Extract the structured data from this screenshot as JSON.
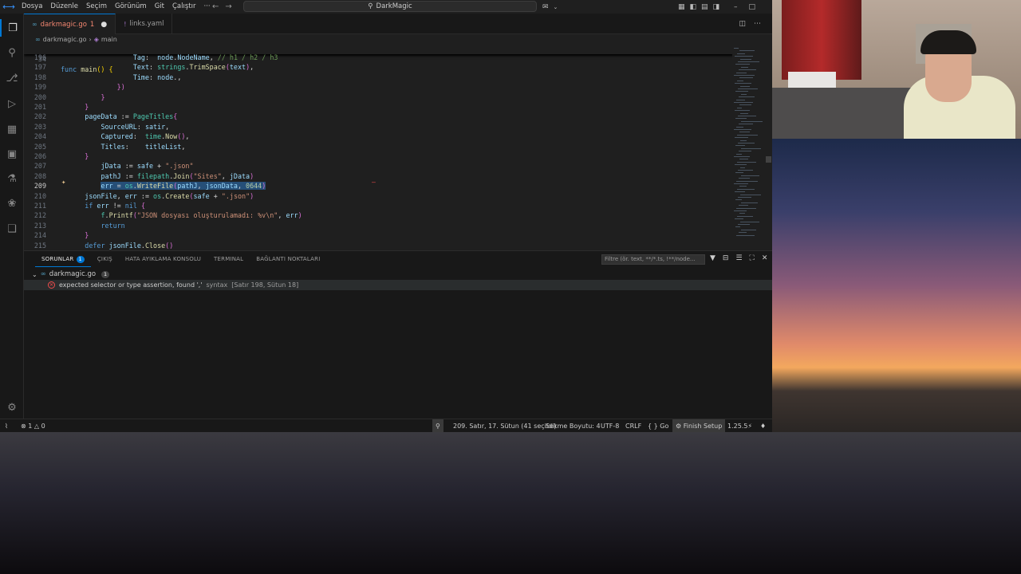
{
  "titlebar": {
    "menus": [
      "Dosya",
      "Düzenle",
      "Seçim",
      "Görünüm",
      "Git",
      "Çalıştır",
      "···"
    ],
    "search_text": "DarkMagic",
    "back_icon": "arrow-left-icon",
    "forward_icon": "arrow-right-icon"
  },
  "tabs": [
    {
      "label": "darkmagic.go",
      "count": "1",
      "active": true
    },
    {
      "label": "links.yaml",
      "active": false
    }
  ],
  "breadcrumb": {
    "file": "darkmagic.go",
    "symbol": "main"
  },
  "editor": {
    "sticky_line_number": "34",
    "sticky_code": "func main() {",
    "lines": [
      {
        "n": "196",
        "code": "                  Tag:  node.NodeName, // h1 / h2 / h3"
      },
      {
        "n": "197",
        "code": "                  Text: strings.TrimSpace(text),"
      },
      {
        "n": "198",
        "code": "                  Time: node.,"
      },
      {
        "n": "199",
        "code": "              })"
      },
      {
        "n": "200",
        "code": "          }"
      },
      {
        "n": "201",
        "code": "      }"
      },
      {
        "n": "202",
        "code": "      pageData := PageTitles{"
      },
      {
        "n": "203",
        "code": "          SourceURL: satir,"
      },
      {
        "n": "204",
        "code": "          Captured:  time.Now(),"
      },
      {
        "n": "205",
        "code": "          Titles:    titleList,"
      },
      {
        "n": "206",
        "code": "      }"
      },
      {
        "n": "207",
        "code": "          jData := safe + \".json\""
      },
      {
        "n": "208",
        "code": "          pathJ := filepath.Join(\"Sites\", jData)"
      },
      {
        "n": "209",
        "code": "          err = os.WriteFile(pathJ, jsonData, 0644)"
      },
      {
        "n": "210",
        "code": "      jsonFile, err := os.Create(safe + \".json\")"
      },
      {
        "n": "211",
        "code": "      if err != nil {"
      },
      {
        "n": "212",
        "code": "          f.Printf(\"JSON dosyası oluşturulamadı: %v\\n\", err)"
      },
      {
        "n": "213",
        "code": "          return"
      },
      {
        "n": "214",
        "code": "      }"
      },
      {
        "n": "215",
        "code": "      defer jsonFile.Close()"
      }
    ]
  },
  "panel": {
    "tabs": [
      "SORUNLAR",
      "ÇIKIŞ",
      "HATA AYIKLAMA KONSOLU",
      "TERMINAL",
      "BAĞLANTI NOKTALARI"
    ],
    "problems_count": "1",
    "filter_placeholder": "Filtre (ör. text, **/*.ts, !**/node...",
    "file": "darkmagic.go",
    "file_count": "1",
    "problem_message": "expected selector or type assertion, found ','",
    "problem_source": "syntax",
    "problem_location": "[Satır 198, Sütun 18]"
  },
  "statusbar": {
    "errors": "1",
    "warnings": "0",
    "position": "209. Satır, 17. Sütun (41 seçildi)",
    "indent": "Sekme Boyutu: 4",
    "encoding": "UTF-8",
    "eol": "CRLF",
    "language": "Go",
    "finish_setup": "Finish Setup",
    "go_version": "1.25.5"
  }
}
